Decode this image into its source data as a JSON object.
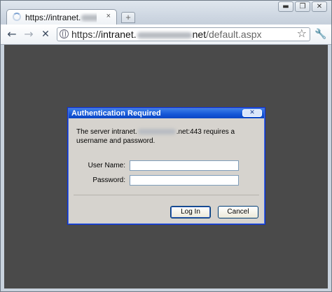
{
  "tab": {
    "title_prefix": "https://intranet.",
    "close_glyph": "×",
    "new_tab_glyph": "+"
  },
  "window_controls": {
    "minimize": "▬",
    "maximize": "❐",
    "close": "✕"
  },
  "toolbar": {
    "back_glyph": "←",
    "forward_glyph": "→",
    "stop_glyph": "✕",
    "url_scheme": "https://",
    "url_host_prefix": "intranet.",
    "url_host_suffix": "net",
    "url_path": "/default.aspx",
    "star_glyph": "☆",
    "wrench_glyph": "🔧"
  },
  "dialog": {
    "title": "Authentication Required",
    "close_glyph": "✕",
    "message_prefix": "The server intranet.",
    "message_suffix": ".net:443 requires a username and password.",
    "username_label": "User Name:",
    "username_value": "",
    "password_label": "Password:",
    "password_value": "",
    "login_label": "Log In",
    "cancel_label": "Cancel"
  },
  "colors": {
    "content_bg": "#4a4a4a",
    "dialog_bg": "#d6d3ce",
    "dialog_title": "#1456d6"
  }
}
